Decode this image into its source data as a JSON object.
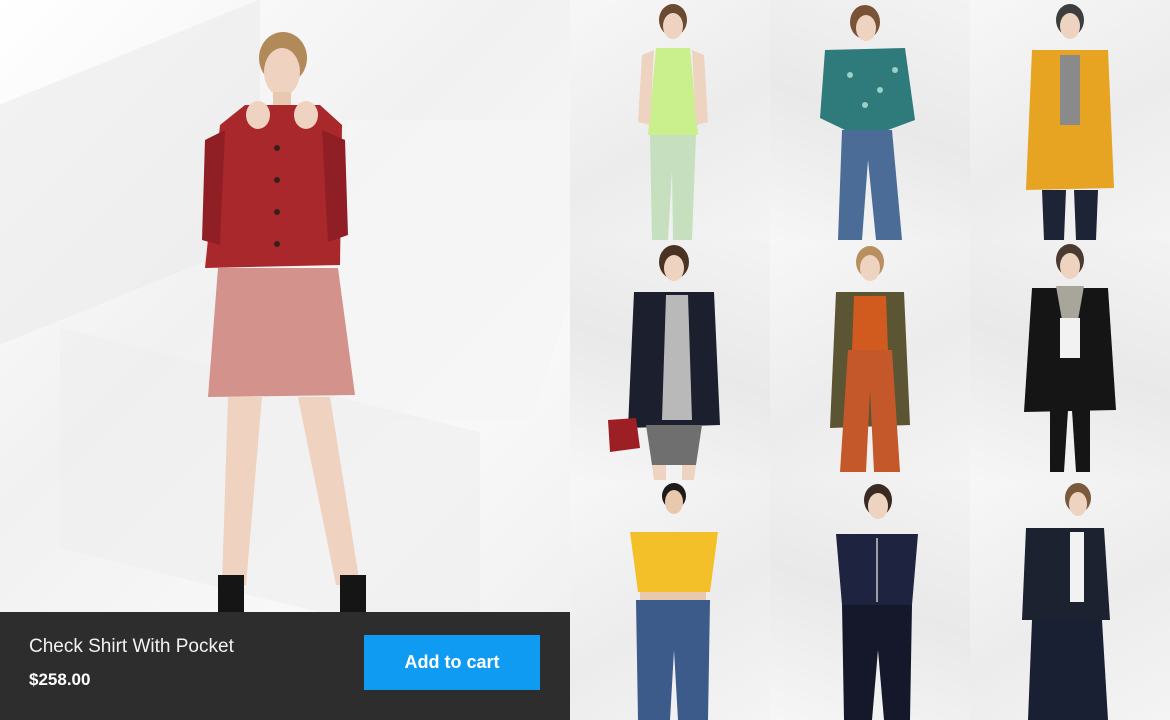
{
  "featured": {
    "product_name": "Check Shirt With Pocket",
    "price": "$258.00",
    "add_to_cart_label": "Add to cart",
    "button_color": "#0f9bf2",
    "image_subject": "model in red suede jacket and pink mini skirt"
  },
  "grid": {
    "items": [
      {
        "image_subject": "model in lime green tank top and mint trousers"
      },
      {
        "image_subject": "model in teal patterned poncho and flared jeans"
      },
      {
        "image_subject": "model in mustard yellow coat"
      },
      {
        "image_subject": "model in navy coat over patterned dress with red bag"
      },
      {
        "image_subject": "model in olive cardigan, rust top and culottes"
      },
      {
        "image_subject": "model in black cardigan with grey scarf"
      },
      {
        "image_subject": "model in yellow crop top and blue jeans"
      },
      {
        "image_subject": "model in navy top with zip and trousers"
      },
      {
        "image_subject": "model in navy pea coat and wide skirt"
      }
    ]
  }
}
